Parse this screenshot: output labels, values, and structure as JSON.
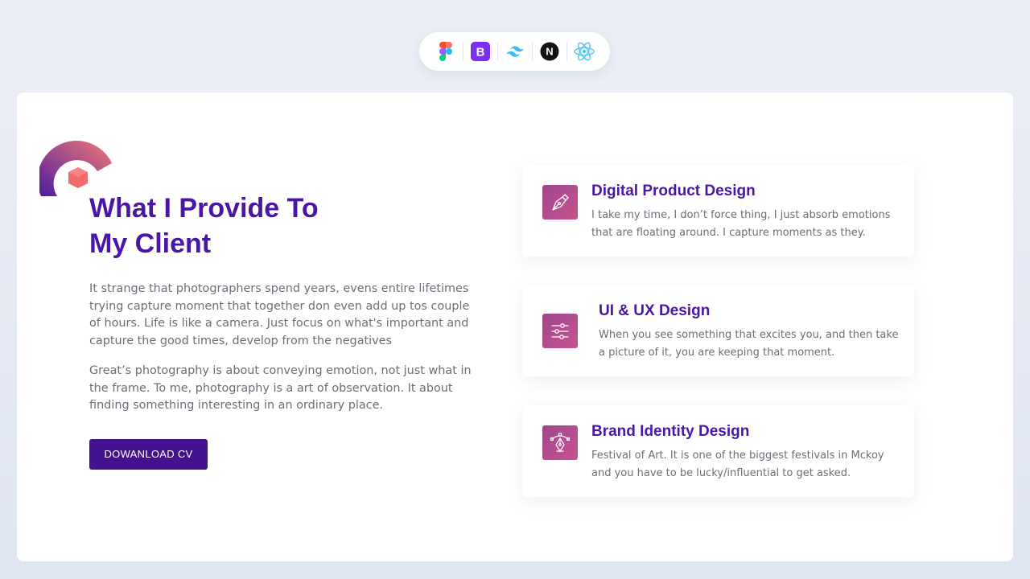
{
  "tech_stack": [
    {
      "name": "figma-icon"
    },
    {
      "name": "bootstrap-icon",
      "glyph": "B"
    },
    {
      "name": "tailwind-icon"
    },
    {
      "name": "nextjs-icon",
      "glyph": "N"
    },
    {
      "name": "react-icon"
    }
  ],
  "intro": {
    "title_line1": "What I Provide To",
    "title_line2": "My Client",
    "paragraph1": "It strange that photographers spend years, evens entire lifetimes trying capture moment that together don even add up tos couple of hours. Life is like a camera. Just focus on what's important and capture the good times, develop from the negatives",
    "paragraph2": "Great’s photography is about conveying emotion, not just what in the frame. To me, photography is a art of observation. It about finding something interesting in an ordinary place.",
    "button_label": "DOWANLOAD CV"
  },
  "services": [
    {
      "icon": "pen-nib-icon",
      "title": "Digital Product Design",
      "description": "I take my time, I don’t force thing, I just absorb emotions that are floating around. I capture moments as they."
    },
    {
      "icon": "sliders-icon",
      "title": "UI & UX Design",
      "description": "When you see something that excites you, and then take a picture of it, you are keeping that moment."
    },
    {
      "icon": "vector-pen-icon",
      "title": "Brand Identity Design",
      "description": "Festival of Art. It is one of the biggest festivals in Mckoy and you have to be lucky/influential to get asked."
    }
  ],
  "colors": {
    "accent": "#4b15a8",
    "button": "#43128f",
    "icon_gradient_start": "#a0468f",
    "icon_gradient_end": "#c7548d",
    "body_text": "#6c6e78"
  }
}
